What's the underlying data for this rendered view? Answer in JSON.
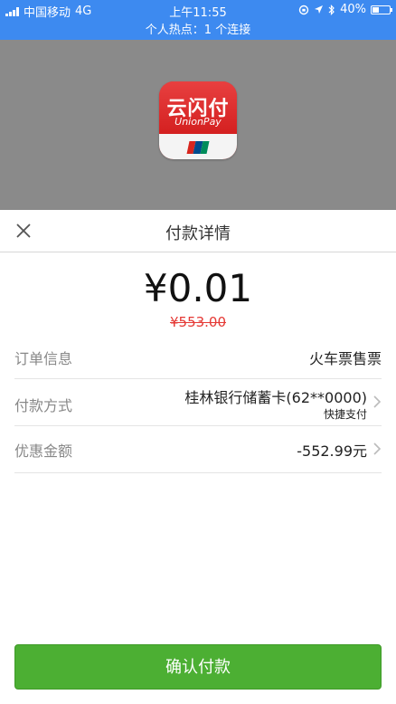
{
  "status_bar": {
    "carrier": "中国移动",
    "network": "4G",
    "time": "上午11:55",
    "battery_text": "40%",
    "battery_level": 0.4,
    "hotspot_text": "个人热点：1 个连接",
    "bar_color": "#3d8af0"
  },
  "app": {
    "name_cn": "云闪付",
    "name_en": "UnionPay",
    "icon": "unionpay-app-icon"
  },
  "sheet": {
    "title": "付款详情",
    "close_icon": "close-icon",
    "amount": "¥0.01",
    "original_amount": "¥553.00",
    "rows": [
      {
        "label": "订单信息",
        "value": "火车票售票"
      },
      {
        "label": "付款方式",
        "value": "桂林银行储蓄卡(62**0000)",
        "sub": "快捷支付"
      },
      {
        "label": "优惠金额",
        "value": "-552.99元"
      }
    ],
    "confirm_label": "确认付款",
    "accent_color": "#4caf33",
    "strike_color": "#e53935"
  }
}
